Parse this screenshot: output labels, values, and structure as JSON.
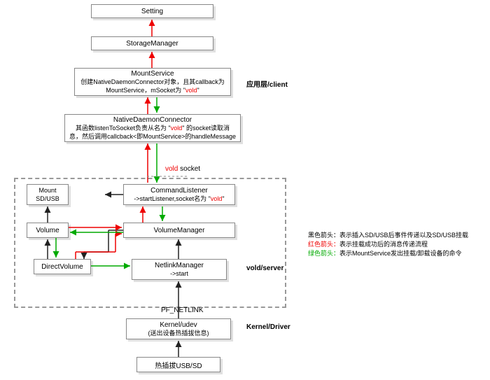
{
  "nodes": {
    "setting": {
      "title": "Setting"
    },
    "storageManager": {
      "title": "StorageManager"
    },
    "mountService": {
      "title": "MountService",
      "line1_a": "创建NativeDaemonConnector对象，且其callback为",
      "line2_a": "MountService，mSocket为 \"",
      "line2_red": "vold",
      "line2_b": "\""
    },
    "ndc": {
      "title": "NativeDaemonConnector",
      "line1_a": "其函数listenToSocket负责从名为 \"",
      "line1_red": "vold",
      "line1_b": "\" 的socket读取消",
      "line2": "息，然后调用callcback<即MountService>的handleMessage"
    },
    "voldSocket_a": "vold",
    "voldSocket_b": " socket",
    "mountSdUsb": {
      "l1": "Mount",
      "l2": "SD/USB"
    },
    "commandListener": {
      "title": "CommandListener",
      "line_a": "->startListener,socket名为 \"",
      "line_red": "vold",
      "line_b": "\""
    },
    "volume": {
      "title": "Volume"
    },
    "volumeManager": {
      "title": "VolumeManager"
    },
    "directVolume": {
      "title": "DirectVolume"
    },
    "netlinkManager": {
      "title": "NetlinkManager",
      "sub": "->start"
    },
    "pfNetlink": "PF_NETLINK",
    "kernel": {
      "title": "Kernel/udev",
      "sub": "(送出设备热插拔信息)"
    },
    "hotplug": {
      "title": "热插拔USB/SD"
    }
  },
  "labels": {
    "appLayer": "应用层/client",
    "voldServer": "vold/server",
    "kernelDriver": "Kernel/Driver"
  },
  "legend": {
    "black_k": "黑色箭头：",
    "black_v": "表示插入SD/USB后事件传递以及SD/USB挂载",
    "red_k": "红色箭头：",
    "red_v": "表示挂载成功后的消息传递流程",
    "green_k": "绿色箭头：",
    "green_v": "表示MountService发出挂载/卸载设备的命令"
  }
}
